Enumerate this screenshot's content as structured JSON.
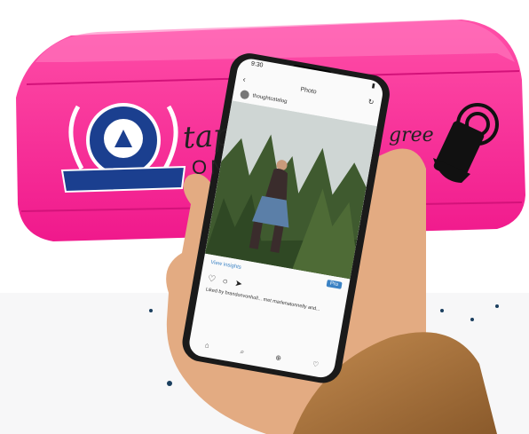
{
  "pouch": {
    "color": "#f0198c",
    "tagline_tap": "tap",
    "tagline_on": "ON",
    "tagline_tail": "gree"
  },
  "phone": {
    "status_time": "9:30",
    "screen_title": "Photo",
    "post_username": "thoughtcatalog",
    "view_insights": "View insights",
    "promote_label": "Pro",
    "caption": "Liked by brandonvonholl... met marlenatonnelly and..."
  },
  "icons": [
    "back-arrow-icon",
    "refresh-icon",
    "heart-icon",
    "comment-icon",
    "share-icon",
    "home-icon",
    "search-icon",
    "add-post-icon",
    "activity-icon",
    "tap-phone-icon"
  ]
}
